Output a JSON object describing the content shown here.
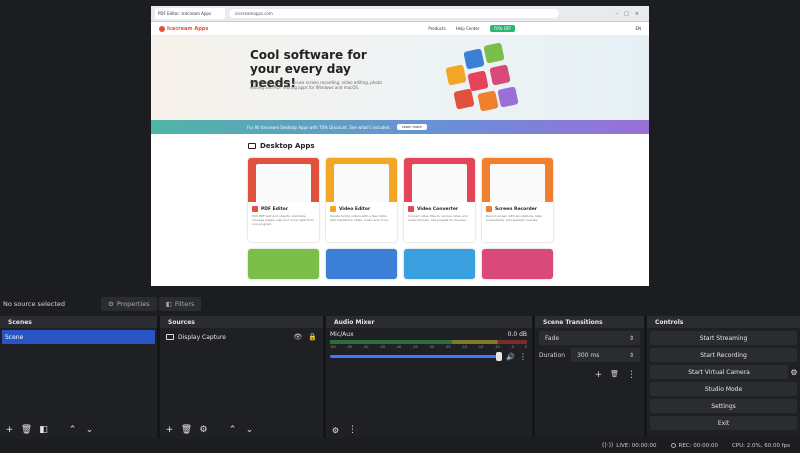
{
  "preview": {
    "browser": {
      "tab_title": "PDF Editor: Icecream Apps",
      "url": "icecreamapps.com"
    },
    "site": {
      "logo": "Icecream Apps",
      "nav_products": "Products",
      "nav_help": "Help Center",
      "nav_cta": "70% OFF",
      "nav_lang": "EN",
      "hero_title": "Cool software for your every day needs!",
      "hero_desc": "Enjoy best and easy-to-use screen recording, video editing, photo editing and PDF editing apps for Windows and macOS.",
      "promo_text": "For All Icecream Desktop Apps with 70% Discount. See what's included.",
      "promo_button": "Learn more",
      "section_title": "Desktop Apps",
      "cards": [
        {
          "name": "PDF Editor",
          "desc": "Edit PDF text and objects, annotate, manage pages, sign and more right from one program.",
          "color": "#e0523d"
        },
        {
          "name": "Video Editor",
          "desc": "Create family videos with a few clicks. Add transitions, titles, music and more.",
          "color": "#f2a623"
        },
        {
          "name": "Video Converter",
          "desc": "Convert video files to various video and audio formats. Use presets for devices.",
          "color": "#e4455a"
        },
        {
          "name": "Screen Recorder",
          "desc": "Record screen with annotations, take screenshots, add webcam overlay.",
          "color": "#f0802e"
        }
      ],
      "row2_colors": [
        "#7bbf4a",
        "#3b7fd6",
        "#3aa0e0",
        "#d94a7a"
      ]
    }
  },
  "source_bar": {
    "no_source": "No source selected",
    "properties": "Properties",
    "filters": "Filters"
  },
  "scenes": {
    "title": "Scenes",
    "items": [
      "Scene"
    ]
  },
  "sources": {
    "title": "Sources",
    "items": [
      {
        "name": "Display Capture"
      }
    ]
  },
  "mixer": {
    "title": "Audio Mixer",
    "track_name": "Mic/Aux",
    "track_db": "0.0 dB",
    "scale": [
      "-60",
      "-55",
      "-50",
      "-45",
      "-40",
      "-35",
      "-30",
      "-25",
      "-20",
      "-15",
      "-10",
      "-5",
      "0"
    ],
    "volume_percent": 100
  },
  "transitions": {
    "title": "Scene Transitions",
    "selected": "Fade",
    "duration_label": "Duration",
    "duration_value": "300 ms"
  },
  "controls": {
    "title": "Controls",
    "start_streaming": "Start Streaming",
    "start_recording": "Start Recording",
    "start_virtual_camera": "Start Virtual Camera",
    "studio_mode": "Studio Mode",
    "settings": "Settings",
    "exit": "Exit"
  },
  "status": {
    "live": "LIVE: 00:00:00",
    "rec": "REC: 00:00:00",
    "cpu": "CPU: 2.0%, 60.00 fps"
  },
  "colors": {
    "accent": "#2a54c4",
    "panel": "#1f2024",
    "titlebar": "#2a2c31"
  }
}
